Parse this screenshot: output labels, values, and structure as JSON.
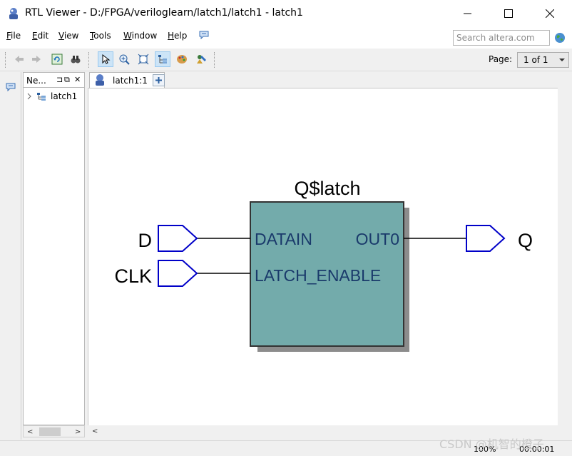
{
  "window": {
    "title": "RTL Viewer - D:/FPGA/veriloglearn/latch1/latch1 - latch1",
    "controls": [
      "minimize-icon",
      "maximize-icon",
      "close-icon"
    ]
  },
  "menu": {
    "items": [
      {
        "mnemonic": "F",
        "rest": "ile"
      },
      {
        "mnemonic": "E",
        "rest": "dit"
      },
      {
        "mnemonic": "V",
        "rest": "iew"
      },
      {
        "mnemonic": "T",
        "rest": "ools"
      },
      {
        "mnemonic": "W",
        "rest": "indow"
      },
      {
        "mnemonic": "H",
        "rest": "elp"
      }
    ],
    "search_placeholder": "Search altera.com"
  },
  "toolbar": {
    "icons": [
      "back-icon",
      "forward-icon",
      "refresh-icon",
      "find-icon",
      "selection-tool-icon",
      "zoom-tool-icon",
      "fit-window-icon",
      "hierarchy-list-icon",
      "color-settings-icon",
      "netlist-navigator-icon"
    ],
    "page_label": "Page:",
    "page_value": "1 of 1"
  },
  "navigator": {
    "title": "Ne...",
    "items": [
      {
        "label": "latch1"
      }
    ]
  },
  "tabs": [
    {
      "label": "latch1:1"
    }
  ],
  "schematic": {
    "block_name": "Q$latch",
    "inputs": [
      "D",
      "CLK"
    ],
    "input_ports": [
      "DATAIN",
      "LATCH_ENABLE"
    ],
    "output_port": "OUT0",
    "output": "Q",
    "colors": {
      "block_fill": "#73abab",
      "port_text": "#1a3a6b",
      "pin_stroke": "#0000c8"
    }
  },
  "status": {
    "zoom": "100%",
    "time": "00:00:01"
  },
  "watermark": "CSDN @机智的橙子"
}
